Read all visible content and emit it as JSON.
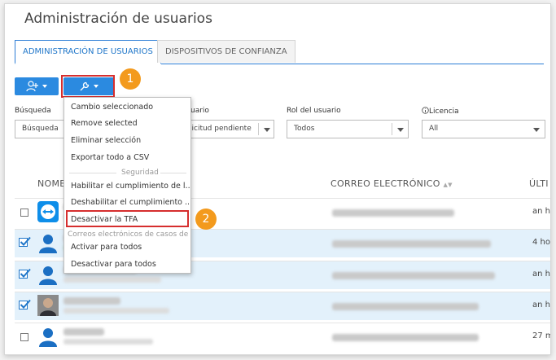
{
  "page": {
    "title": "Administración de usuarios"
  },
  "tabs": [
    {
      "label": "ADMINISTRACIÓN DE USUARIOS",
      "active": true
    },
    {
      "label": "DISPOSITIVOS DE CONFIANZA",
      "active": false
    }
  ],
  "toolbar": {
    "add_user_icon": "add-user-icon",
    "tools_icon": "wrench-icon"
  },
  "callouts": [
    "1",
    "2"
  ],
  "filters": {
    "search": {
      "label": "Búsqueda",
      "placeholder": "Búsqueda"
    },
    "status": {
      "label_partial": "uario",
      "value_partial": "licitud pendiente"
    },
    "role": {
      "label": "Rol del usuario",
      "value": "Todos"
    },
    "license": {
      "label": "Licencia",
      "value": "All",
      "icon": "info-icon"
    }
  },
  "table": {
    "headers": {
      "name": "NOMBRE",
      "email": "CORREO ELECTRÓNICO",
      "last": "ÚLTI"
    }
  },
  "rows": [
    {
      "selected": false,
      "avatar": "teamviewer-logo",
      "time": "an hou"
    },
    {
      "selected": true,
      "avatar": "person-icon",
      "time": "4 hou"
    },
    {
      "selected": true,
      "avatar": "person-icon",
      "time": "an hou"
    },
    {
      "selected": true,
      "avatar": "photo",
      "time": "an hou"
    },
    {
      "selected": false,
      "avatar": "person-icon",
      "time": "27 mi"
    }
  ],
  "menu": {
    "items": [
      "Cambio seleccionado",
      "Remove selected",
      "Eliminar selección",
      "Exportar todo a CSV"
    ],
    "section_security": "Seguridad",
    "security_items": [
      "Habilitar el cumplimiento de l...",
      "Deshabilitar el cumplimiento ...",
      "Desactivar la TFA"
    ],
    "section_email": "Correos electrónicos de casos de s",
    "email_items": [
      "Activar para todos",
      "Desactivar para todos"
    ]
  },
  "colors": {
    "accent": "#2b8ae0",
    "callout": "#f39a1d",
    "highlight": "#d62e2e",
    "selected_row": "#e3f1fb"
  }
}
